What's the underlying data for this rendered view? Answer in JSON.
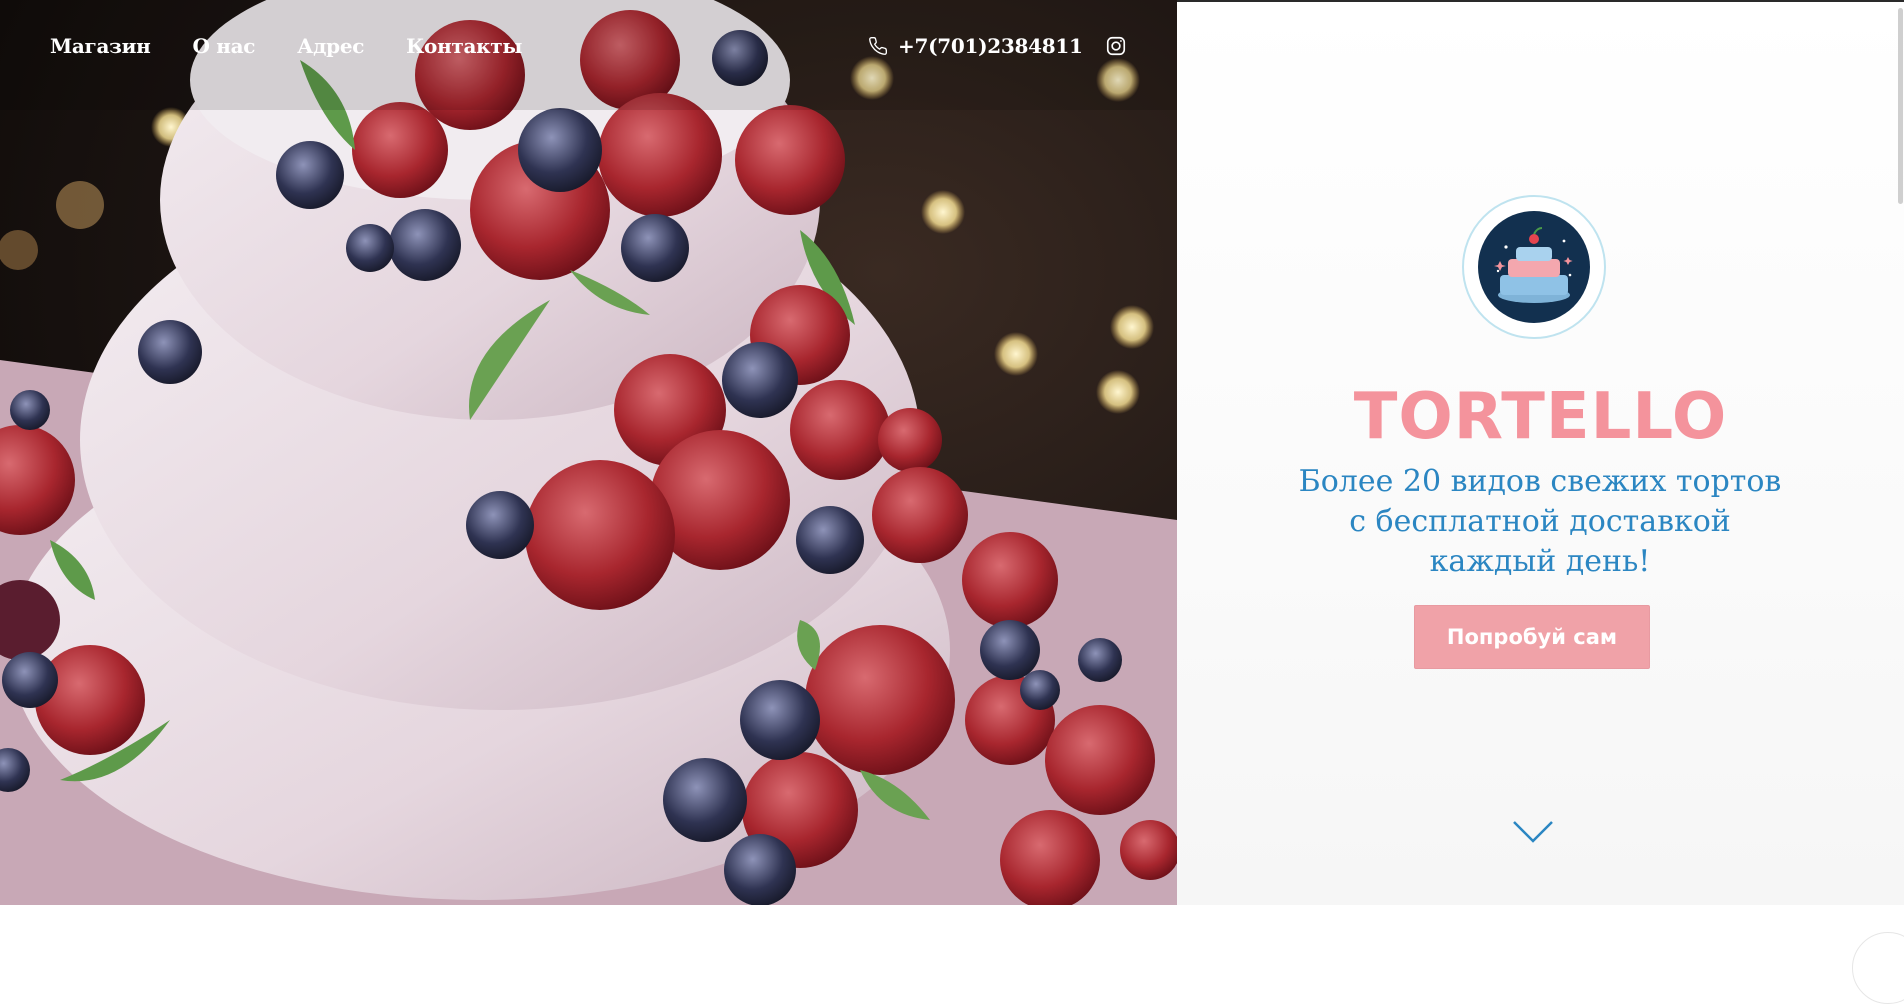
{
  "nav": {
    "items": [
      {
        "label": "Магазин"
      },
      {
        "label": "О нас"
      },
      {
        "label": "Адрес"
      },
      {
        "label": "Контакты"
      }
    ]
  },
  "contact": {
    "phone": "+7(701)2384811",
    "phone_icon": "phone-icon",
    "instagram_icon": "instagram-icon"
  },
  "hero": {
    "brand": "TORTELLO",
    "tagline": "Более 20 видов свежих тортов с бесплатной доставкой каждый день!",
    "cta_label": "Попробуй сам",
    "logo_icon": "cake-logo-icon",
    "scroll_icon": "chevron-down-icon"
  },
  "colors": {
    "brand_pink": "#f4939c",
    "tagline_blue": "#2b86c2",
    "cta_pink": "#f0a2a8"
  }
}
